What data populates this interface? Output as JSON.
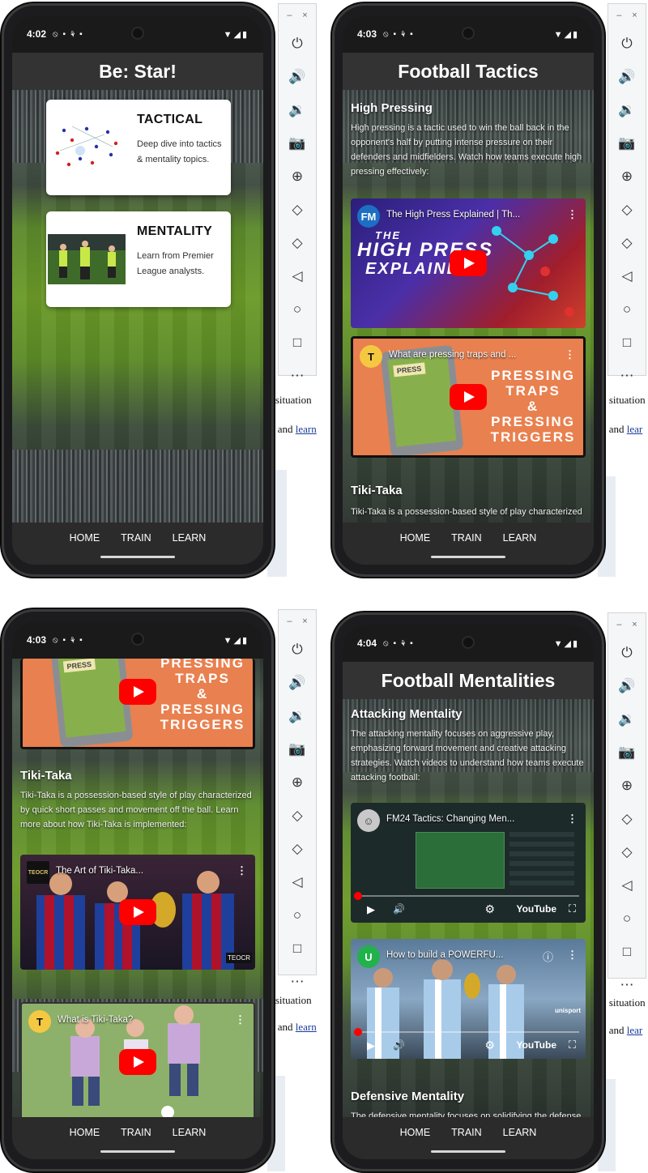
{
  "nav": {
    "home": "HOME",
    "train": "TRAIN",
    "learn": "LEARN"
  },
  "doc_fragments": {
    "a": "l situation",
    "b": "h and ",
    "b_link": "learn",
    "c": "situation",
    "d": "lear",
    "e": "o"
  },
  "panels": {
    "p1": {
      "status_time": "4:02",
      "title": "Be: Star!",
      "cards": [
        {
          "heading": "TACTICAL",
          "text": "Deep dive into tactics & mentality topics."
        },
        {
          "heading": "MENTALITY",
          "text": "Learn from Premier League analysts."
        }
      ]
    },
    "p2": {
      "status_time": "4:03",
      "title": "Football Tactics",
      "section1_heading": "High Pressing",
      "section1_text": "High pressing is a tactic used to win the ball back in the opponent's half by putting intense pressure on their defenders and midfielders. Watch how teams execute high pressing effectively:",
      "video1_title": "The High Press Explained | Th...",
      "video1_logo": "FM",
      "video1_overlay": [
        "THE",
        "HIGH PRESS",
        "EXPLAINED"
      ],
      "video2_title": "What are pressing traps and ...",
      "video2_logo": "T",
      "video2_overlay": [
        "PRESSING",
        "TRAPS",
        "&",
        "PRESSING",
        "TRIGGERS"
      ],
      "video2_tablet_label": "PRESS",
      "section2_heading": "Tiki-Taka",
      "section2_text": "Tiki-Taka is a possession-based style of play characterized by quick short passes and movement"
    },
    "p3": {
      "status_time": "4:03",
      "video_top_overlay": [
        "PRESSING",
        "TRAPS",
        "&",
        "PRESSING",
        "TRIGGERS"
      ],
      "video_top_tablet_label": "PRESS",
      "section_heading": "Tiki-Taka",
      "section_text": "Tiki-Taka is a possession-based style of play characterized by quick short passes and movement off the ball. Learn more about how Tiki-Taka is implemented:",
      "video1_title": "The Art of Tiki-Taka...",
      "video1_logo": "TEOCR",
      "video1_corner_badge": "TEOCR",
      "video2_title": "What is Tiki-Taka?",
      "video2_logo": "T"
    },
    "p4": {
      "status_time": "4:04",
      "title": "Football Mentalities",
      "section1_heading": "Attacking Mentality",
      "section1_text": "The attacking mentality focuses on aggressive play, emphasizing forward movement and creative attacking strategies. Watch videos to understand how teams execute attacking football:",
      "video1_title": "FM24 Tactics: Changing Men...",
      "video2_title": "How to build a POWERFU...",
      "video2_logo": "U",
      "video2_brand": "unisport",
      "youtube_label": "YouTube",
      "section2_heading": "Defensive Mentality",
      "section2_text": "The defensive mentality focuses on solidifying the defense, maintaining shape, and counter-attacking"
    }
  },
  "toolbar": {
    "minimize": "–",
    "close": "×"
  },
  "colors": {
    "youtube_red": "#ff0000",
    "appbar": "#333333",
    "navbar": "#2b2b2b",
    "pitch_green": "#6b9a28",
    "tablet_orange": "#e9804f"
  }
}
